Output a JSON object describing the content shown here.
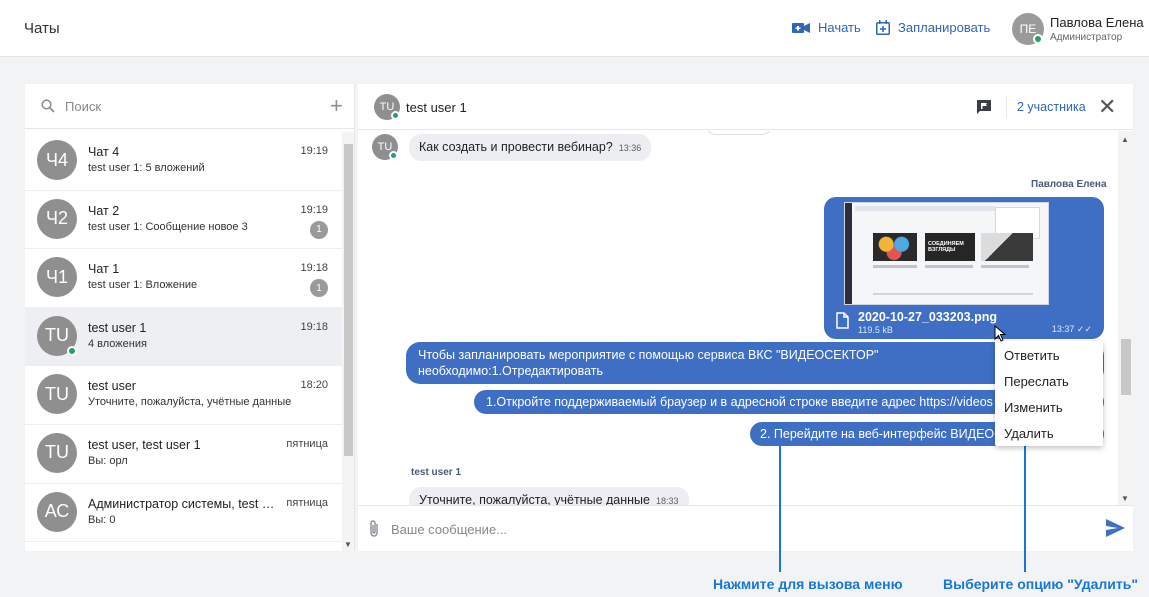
{
  "topbar": {
    "title": "Чаты",
    "start_label": "Начать",
    "schedule_label": "Запланировать",
    "user_initials": "ПЕ",
    "user_name": "Павлова Елена",
    "user_role": "Администратор"
  },
  "sidebar": {
    "search_placeholder": "Поиск",
    "chats": [
      {
        "initials": "Ч4",
        "name": "Чат 4",
        "preview": "test user 1: 5 вложений",
        "time": "19:19",
        "badge": ""
      },
      {
        "initials": "Ч2",
        "name": "Чат 2",
        "preview": "test user 1: Сообщение новое 3",
        "time": "19:19",
        "badge": "1"
      },
      {
        "initials": "Ч1",
        "name": "Чат 1",
        "preview": "test user 1: Вложение",
        "time": "19:18",
        "badge": "1"
      },
      {
        "initials": "TU",
        "name": "test user 1",
        "preview": "4 вложения",
        "time": "19:18",
        "badge": "",
        "active": true,
        "online": true
      },
      {
        "initials": "TU",
        "name": "test user",
        "preview": "Уточните, пожалуйста, учётные данные",
        "time": "18:20",
        "badge": ""
      },
      {
        "initials": "TU",
        "name": "test user, test user 1",
        "preview": "Вы: орл",
        "time": "пятница",
        "badge": ""
      },
      {
        "initials": "АС",
        "name": "Администратор системы, test user",
        "preview": "Вы: 0",
        "time": "пятница",
        "badge": ""
      }
    ]
  },
  "conversation": {
    "initials": "TU",
    "name": "test user 1",
    "members_label": "2 участника",
    "messages": {
      "m1_initials": "TU",
      "m1_text": "Как создать и провести вебинар?",
      "m1_time": "13:36",
      "own_sender": "Павлова Елена",
      "attachment_name": "2020-10-27_033203.png",
      "attachment_size": "119.5 kB",
      "attachment_time": "13:37",
      "thumb_banner": "СОЕДИНЯЕМ ВЗГЛЯДЫ",
      "out1_line1": "Чтобы запланировать мероприятие с помощью сервиса ВКС \"ВИДЕОСЕКТОР\"",
      "out1_line2": "необходимо:1.Отредактировать",
      "out2": "1.Откройте поддерживаемый браузер и в адресной строке введите адрес https://videos",
      "out3": "2. Перейдите на веб-интерфейс ВИДЕОС",
      "in2_sender": "test user 1",
      "in2_text": "Уточните, пожалуйста, учётные данные",
      "in2_time": "18:33"
    },
    "composer_placeholder": "Ваше сообщение..."
  },
  "context_menu": {
    "items": [
      "Ответить",
      "Переслать",
      "Изменить",
      "Удалить"
    ]
  },
  "annotations": {
    "left": "Нажмите для вызова меню",
    "right": "Выберите опцию \"Удалить\""
  },
  "colors": {
    "accent": "#2e66b8",
    "bubble_out": "#3f6fc4",
    "annotation": "#1677d9",
    "online": "#21a366"
  }
}
